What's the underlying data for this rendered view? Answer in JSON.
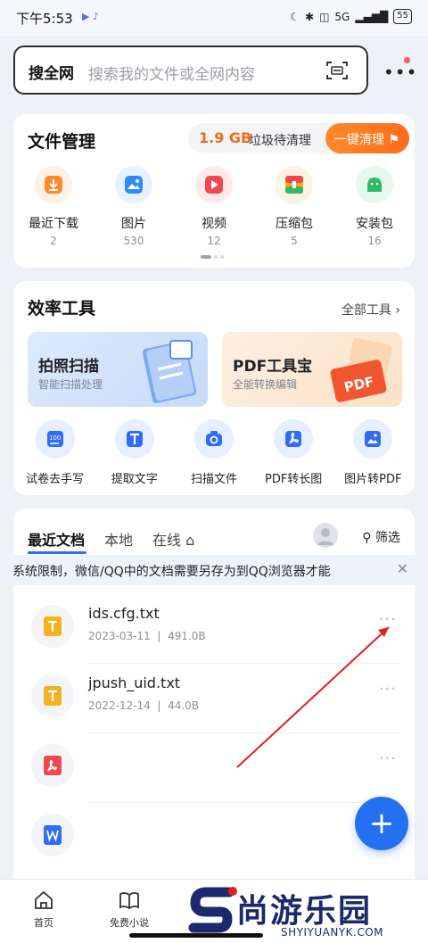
{
  "status_bar": {
    "time": "下午5:53",
    "battery": "55",
    "signal": "5G"
  },
  "search": {
    "prefix": "搜全网",
    "placeholder": "搜索我的文件或全网内容"
  },
  "file_manager": {
    "title": "文件管理",
    "junk_size": "1.9 GB",
    "junk_text": "垃圾待清理",
    "clean_button": "一键清理",
    "items": [
      {
        "label": "最近下载",
        "count": "2",
        "color": "#ff8a2b"
      },
      {
        "label": "图片",
        "count": "530",
        "color": "#2f8cf6"
      },
      {
        "label": "视频",
        "count": "12",
        "color": "#f0484e"
      },
      {
        "label": "压缩包",
        "count": "5",
        "color": "#f5a623"
      },
      {
        "label": "安装包",
        "count": "16",
        "color": "#2dbb66"
      }
    ]
  },
  "tools": {
    "title": "效率工具",
    "all_tools": "全部工具",
    "scan": {
      "title": "拍照扫描",
      "subtitle": "智能扫描处理"
    },
    "pdf": {
      "title": "PDF工具宝",
      "subtitle": "全能转换编辑"
    },
    "items": [
      {
        "label": "试卷去手写"
      },
      {
        "label": "提取文字"
      },
      {
        "label": "扫描文件"
      },
      {
        "label": "PDF转长图"
      },
      {
        "label": "图片转PDF"
      }
    ]
  },
  "docs": {
    "tabs": [
      "最近文档",
      "本地",
      "在线"
    ],
    "filter": "筛选",
    "notice": "系统限制，微信/QQ中的文档需要另存为到QQ浏览器才能",
    "files": [
      {
        "name": "ids.cfg.txt",
        "date": "2023-03-11",
        "size": "491.0B",
        "type": "txt"
      },
      {
        "name": "jpush_uid.txt",
        "date": "2022-12-14",
        "size": "44.0B",
        "type": "txt"
      },
      {
        "name": "",
        "date": "",
        "size": "",
        "type": "pdf"
      },
      {
        "name": "",
        "date": "",
        "size": "",
        "type": "word"
      }
    ]
  },
  "tabbar": {
    "items": [
      {
        "label": "首页"
      },
      {
        "label": "免费小说"
      }
    ]
  },
  "watermark": {
    "title": "尚游乐园",
    "url": "SHYIYUANYK.COM"
  }
}
